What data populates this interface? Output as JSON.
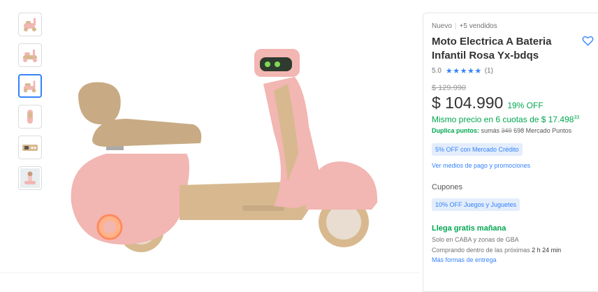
{
  "thumbnails": [
    {
      "icon": "scooter-angle-icon",
      "selected": false
    },
    {
      "icon": "scooter-front-icon",
      "selected": false
    },
    {
      "icon": "scooter-side-icon",
      "selected": true
    },
    {
      "icon": "scooter-top-icon",
      "selected": false
    },
    {
      "icon": "scooter-remote-icon",
      "selected": false
    },
    {
      "icon": "scooter-child-icon",
      "selected": false
    }
  ],
  "product": {
    "condition": "Nuevo",
    "sold": "+5 vendidos",
    "title": "Moto Electrica A Bateria Infantil Rosa Yx-bdqs",
    "rating_value": "5.0",
    "stars": "★★★★★",
    "review_count": "(1)",
    "old_price": "$ 129.990",
    "price": "$ 104.990",
    "discount": "19% OFF",
    "installments_text": "Mismo precio en 6 cuotas de $ 17.498",
    "installments_cents": "33",
    "points_label": "Duplica puntos:",
    "points_prefix": "sumás",
    "points_old": "349",
    "points_new": "698 Mercado Puntos",
    "credit_offer": "5% OFF con Mercado Crédito",
    "payment_link": "Ver medios de pago y promociones",
    "coupons_label": "Cupones",
    "coupon": "10% OFF Juegos y Juguetes",
    "shipping_title": "Llega gratis mañana",
    "shipping_area": "Solo en CABA y zonas de GBA",
    "shipping_time_prefix": "Comprando dentro de las próximas",
    "shipping_time": "2 h 24 min",
    "shipping_link": "Más formas de entrega"
  },
  "colors": {
    "accent": "#3483fa",
    "green": "#00a650",
    "scooter_pink": "#f2b6b3",
    "scooter_beige": "#d8b98f"
  }
}
